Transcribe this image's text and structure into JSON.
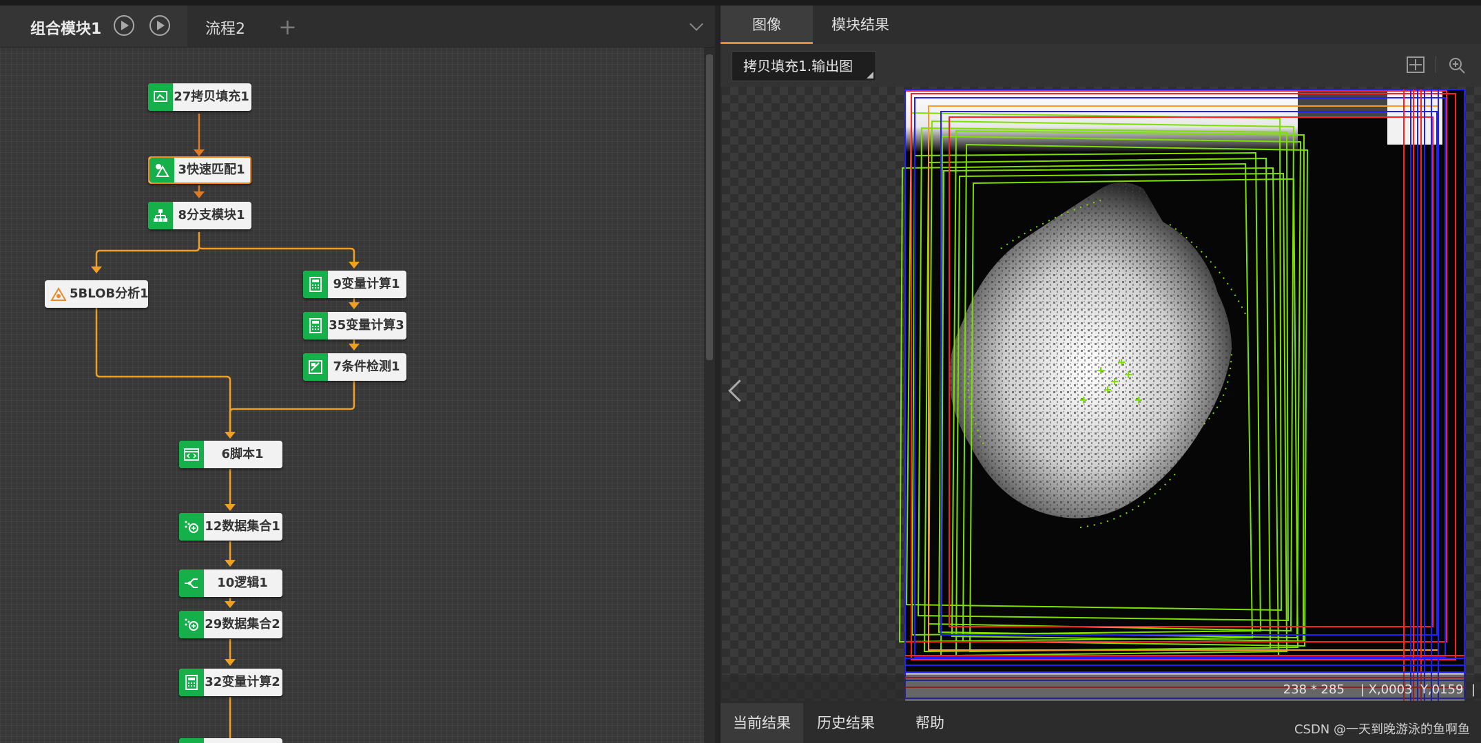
{
  "left_tabs": {
    "title": "组合模块1",
    "second": "流程2",
    "add_label": "+"
  },
  "nodes": [
    {
      "id": "n27",
      "label": "27拷贝填充1"
    },
    {
      "id": "n3",
      "label": "3快速匹配1",
      "selected": true
    },
    {
      "id": "n8",
      "label": "8分支模块1"
    },
    {
      "id": "n5",
      "label": "5BLOB分析1"
    },
    {
      "id": "n9",
      "label": "9变量计算1"
    },
    {
      "id": "n35",
      "label": "35变量计算3"
    },
    {
      "id": "n7",
      "label": "7条件检测1"
    },
    {
      "id": "n6",
      "label": "6脚本1"
    },
    {
      "id": "n12",
      "label": "12数据集合1"
    },
    {
      "id": "n10",
      "label": "10逻辑1"
    },
    {
      "id": "n29",
      "label": "29数据集合2"
    },
    {
      "id": "n32",
      "label": "32变量计算2"
    }
  ],
  "right_tabs": [
    "图像",
    "模块结果"
  ],
  "image_select": "拷贝填充1.输出图",
  "status": {
    "size": "238 * 285",
    "x": "X,0003",
    "y": "Y,0159",
    "sep": "|"
  },
  "bottom_tabs": [
    "当前结果",
    "历史结果",
    "帮助"
  ],
  "watermark": "CSDN @一天到晚游泳的鱼啊鱼",
  "colors": {
    "accent_orange": "#e88d2a",
    "wire_orange": "#f0a020",
    "node_green": "#16b04a",
    "overlay_green": "#7ee000"
  }
}
